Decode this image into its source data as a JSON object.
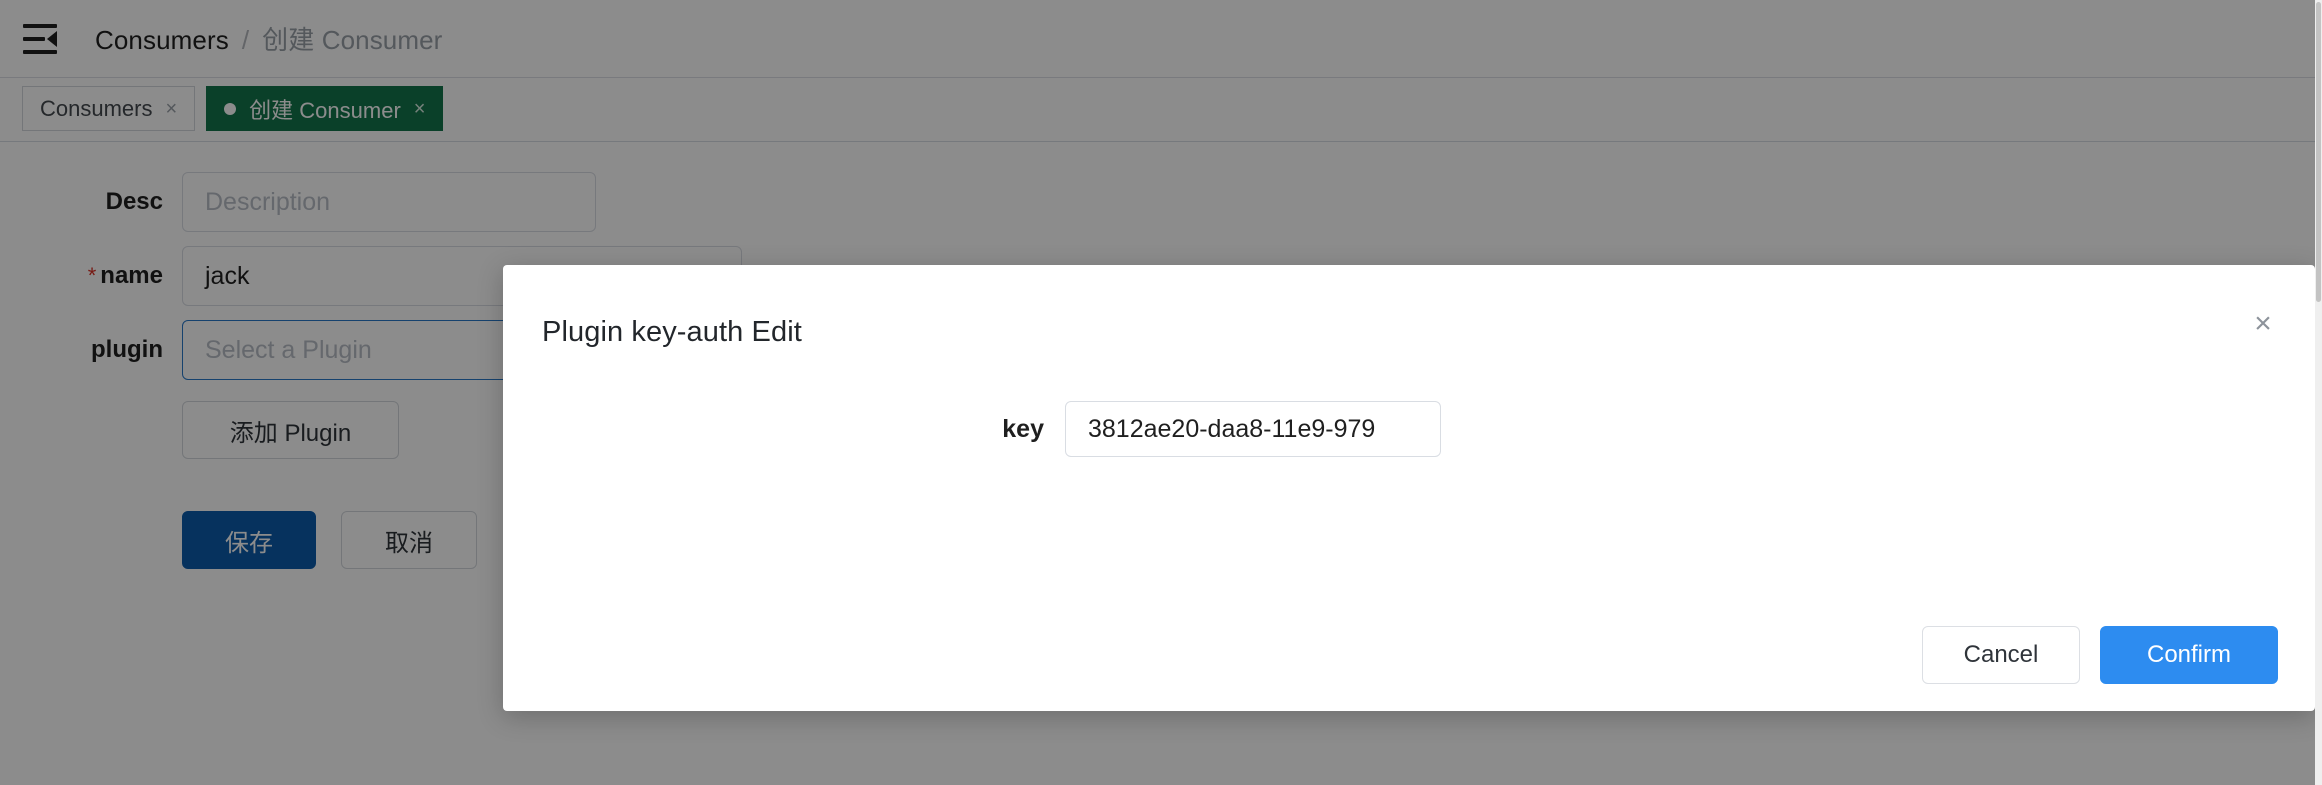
{
  "header": {
    "fold_icon": "menu-fold-icon",
    "breadcrumb": {
      "parent": "Consumers",
      "separator": "/",
      "current": "创建 Consumer"
    }
  },
  "tabs": [
    {
      "label": "Consumers",
      "close": "×",
      "active": false,
      "dot": false
    },
    {
      "label": "创建 Consumer",
      "close": "×",
      "active": true,
      "dot": true
    }
  ],
  "form": {
    "rows": [
      {
        "label": "Desc",
        "required": false,
        "value": "",
        "placeholder": "Description"
      },
      {
        "label": "name",
        "required": true,
        "value": "jack",
        "placeholder": ""
      },
      {
        "label": "plugin",
        "required": false,
        "value": "",
        "placeholder": "Select a Plugin",
        "focused": true
      }
    ],
    "required_mark": "*",
    "add_plugin_label": "添加 Plugin",
    "save_label": "保存",
    "cancel_label": "取消"
  },
  "modal": {
    "title": "Plugin key-auth Edit",
    "close_icon": "×",
    "fields": [
      {
        "label": "key",
        "value": "3812ae20-daa8-11e9-979",
        "placeholder": ""
      }
    ],
    "cancel_label": "Cancel",
    "confirm_label": "Confirm"
  },
  "colors": {
    "tab_active": "#13754b",
    "save_button": "#0b5cab",
    "confirm_button": "#2d8cf0",
    "focus_border": "#2878c8",
    "required_star": "#d93025",
    "overlay": "rgba(0,0,0,0.45)"
  }
}
